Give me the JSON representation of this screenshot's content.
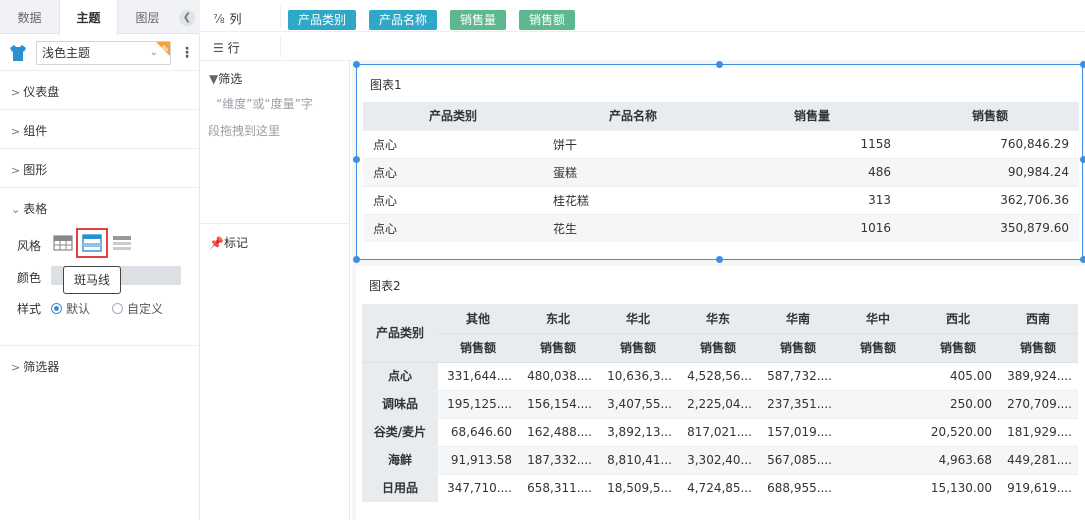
{
  "left_panel": {
    "tabs": [
      "数据",
      "主题",
      "图层"
    ],
    "active_tab": "主题",
    "theme_select_value": "浅色主题",
    "sections": {
      "dashboard": "仪表盘",
      "component": "组件",
      "shape": "图形",
      "table": "表格",
      "filter": "筛选器"
    },
    "style_label": "风格",
    "color_label": "颜色",
    "format_label": "样式",
    "radio_default": "默认",
    "radio_custom": "自定义",
    "tooltip": "斑马线",
    "selected_style": "zebra-style-icon"
  },
  "shelves": {
    "columns_label": "列",
    "rows_label": "行",
    "column_pills": [
      {
        "label": "产品类别",
        "kind": "dimension"
      },
      {
        "label": "产品名称",
        "kind": "dimension"
      },
      {
        "label": "销售量",
        "kind": "measure"
      },
      {
        "label": "销售额",
        "kind": "measure"
      }
    ]
  },
  "middle": {
    "filter_title": "筛选",
    "hint_line1": "“维度”或“度量”字",
    "hint_line2": "段拖拽到这里",
    "mark_title": "标记"
  },
  "chart1": {
    "title": "图表1",
    "headers": [
      "产品类别",
      "产品名称",
      "销售量",
      "销售额"
    ],
    "rows": [
      [
        "点心",
        "饼干",
        "1158",
        "760,846.29"
      ],
      [
        "点心",
        "蛋糕",
        "486",
        "90,984.24"
      ],
      [
        "点心",
        "桂花糕",
        "313",
        "362,706.36"
      ],
      [
        "点心",
        "花生",
        "1016",
        "350,879.60"
      ]
    ]
  },
  "chart2": {
    "title": "图表2",
    "row_header": "产品类别",
    "regions": [
      "其他",
      "东北",
      "华北",
      "华东",
      "华南",
      "华中",
      "西北",
      "西南"
    ],
    "measure": "销售额",
    "rows": [
      {
        "category": "点心",
        "values": [
          "331,644....",
          "480,038....",
          "10,636,3...",
          "4,528,56...",
          "587,732....",
          "",
          "405.00",
          "389,924...."
        ]
      },
      {
        "category": "调味品",
        "values": [
          "195,125....",
          "156,154....",
          "3,407,55...",
          "2,225,04...",
          "237,351....",
          "",
          "250.00",
          "270,709...."
        ]
      },
      {
        "category": "谷类/麦片",
        "values": [
          "68,646.60",
          "162,488....",
          "3,892,13...",
          "817,021....",
          "157,019....",
          "",
          "20,520.00",
          "181,929...."
        ]
      },
      {
        "category": "海鲜",
        "values": [
          "91,913.58",
          "187,332....",
          "8,810,41...",
          "3,302,40...",
          "567,085....",
          "",
          "4,963.68",
          "449,281...."
        ]
      },
      {
        "category": "日用品",
        "values": [
          "347,710....",
          "658,311....",
          "18,509,5...",
          "4,724,85...",
          "688,955....",
          "",
          "15,130.00",
          "919,619...."
        ]
      }
    ]
  },
  "colors": {
    "accent": "#3d8fe0",
    "dimension_pill": "#2fa8c8",
    "measure_pill": "#5eb88f",
    "highlight": "#e04040"
  }
}
